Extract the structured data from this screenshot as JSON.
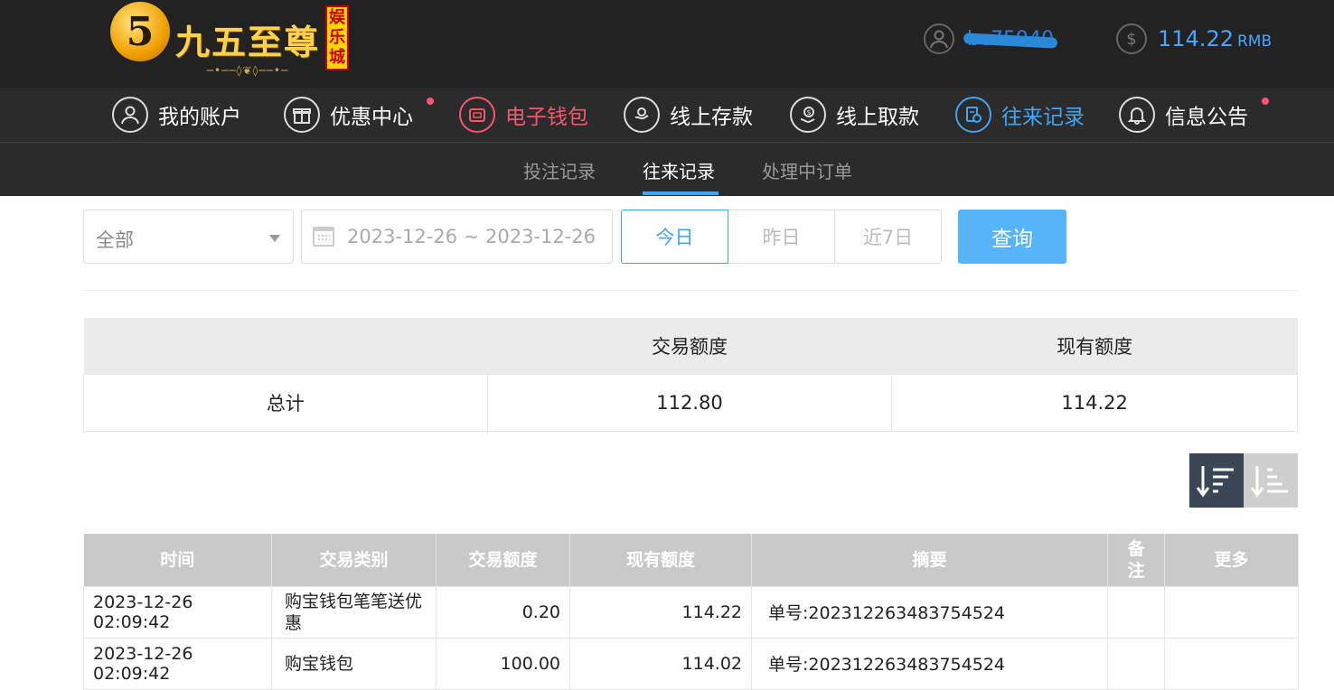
{
  "header": {
    "logo_mark": "5",
    "logo_text": "九五至尊",
    "logo_ornament": "─•──◊❦◊──•─",
    "logo_tag": "娱乐城",
    "user_icon": "user-icon",
    "username": "bc75940",
    "balance_icon": "dollar-icon",
    "balance": "114.22",
    "currency": "RMB"
  },
  "nav": {
    "items": [
      {
        "label": "我的账户",
        "icon": "user-circle-icon"
      },
      {
        "label": "优惠中心",
        "icon": "gift-icon"
      },
      {
        "label": "电子钱包",
        "icon": "wallet-icon"
      },
      {
        "label": "线上存款",
        "icon": "deposit-icon"
      },
      {
        "label": "线上取款",
        "icon": "withdraw-icon"
      },
      {
        "label": "往来记录",
        "icon": "records-icon"
      },
      {
        "label": "信息公告",
        "icon": "bell-icon"
      }
    ]
  },
  "subnav": {
    "items": [
      "投注记录",
      "往来记录",
      "处理中订单"
    ]
  },
  "filters": {
    "type_select": "全部",
    "date_range": "2023-12-26 ~ 2023-12-26",
    "quick": [
      "今日",
      "昨日",
      "近7日"
    ],
    "query": "查询"
  },
  "summary": {
    "headers": [
      "",
      "交易额度",
      "现有额度"
    ],
    "row": [
      "总计",
      "112.80",
      "114.22"
    ]
  },
  "detail": {
    "headers": [
      "时间",
      "交易类别",
      "交易额度",
      "现有额度",
      "摘要",
      "备注",
      "更多"
    ],
    "rows": [
      {
        "time": "2023-12-26 02:09:42",
        "type": "购宝钱包笔笔送优惠",
        "amount": "0.20",
        "balance": "114.22",
        "summary": "单号:202312263483754524",
        "note": "",
        "more": ""
      },
      {
        "time": "2023-12-26 02:09:42",
        "type": "购宝钱包",
        "amount": "100.00",
        "balance": "114.02",
        "summary": "单号:202312263483754524",
        "note": "",
        "more": ""
      }
    ]
  }
}
